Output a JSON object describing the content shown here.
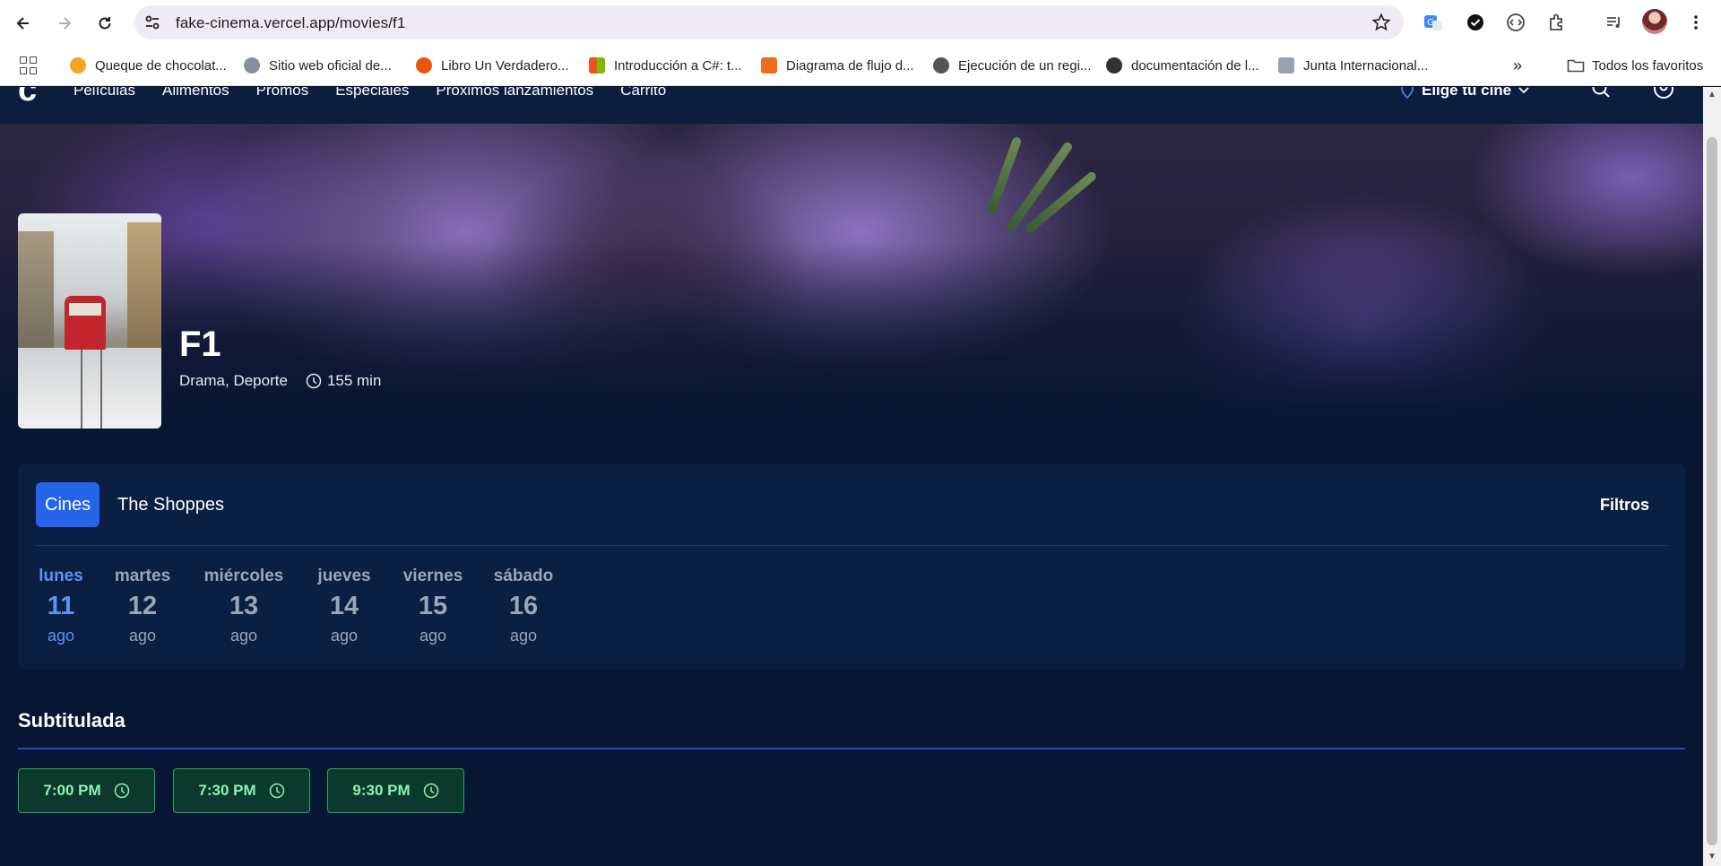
{
  "browser": {
    "url": "fake-cinema.vercel.app/movies/f1",
    "bookmarks": [
      {
        "label": "Queque de chocolat...",
        "color": "#f4a623"
      },
      {
        "label": "Sitio web oficial de...",
        "color": "#8a8fa0"
      },
      {
        "label": "Libro Un Verdadero...",
        "color": "#e8550f"
      },
      {
        "label": "Introducción a C#: t...",
        "color": "#2aa84a"
      },
      {
        "label": "Diagrama de flujo d...",
        "color": "#f06a1d"
      },
      {
        "label": "Ejecución de un regi...",
        "color": "#555555"
      },
      {
        "label": "documentación de l...",
        "color": "#333333"
      },
      {
        "label": "Junta Internacional...",
        "color": "#9aa0b0"
      }
    ],
    "all_bookmarks_label": "Todos los favoritos"
  },
  "site": {
    "logo": "c",
    "menu": [
      "Películas",
      "Alimentos",
      "Promos",
      "Especiales",
      "Próximos lanzamientos",
      "Carrito"
    ],
    "choose_cinema": "Elige tu cine"
  },
  "movie": {
    "title": "F1",
    "genres": "Drama, Deporte",
    "duration": "155 min"
  },
  "schedule": {
    "tabs": [
      "Cines",
      "The Shoppes"
    ],
    "filters_label": "Filtros",
    "days": [
      {
        "name": "lunes",
        "num": "11",
        "month": "ago",
        "active": true
      },
      {
        "name": "martes",
        "num": "12",
        "month": "ago"
      },
      {
        "name": "miércoles",
        "num": "13",
        "month": "ago"
      },
      {
        "name": "jueves",
        "num": "14",
        "month": "ago"
      },
      {
        "name": "viernes",
        "num": "15",
        "month": "ago"
      },
      {
        "name": "sábado",
        "num": "16",
        "month": "ago"
      }
    ],
    "section_title": "Subtitulada",
    "showtimes": [
      "7:00 PM",
      "7:30 PM",
      "9:30 PM"
    ]
  },
  "colors": {
    "accent": "#2563eb",
    "showtime_border": "#1faa63",
    "page_bg": "#061633"
  }
}
